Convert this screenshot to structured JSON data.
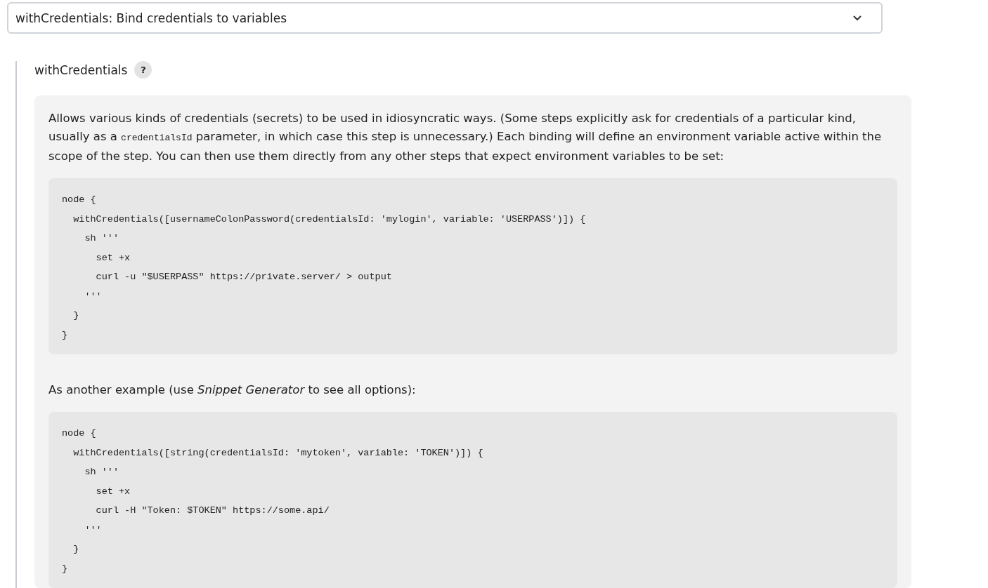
{
  "step_select": {
    "value": "withCredentials: Bind credentials to variables"
  },
  "step": {
    "label": "withCredentials",
    "help_icon": "?"
  },
  "help": {
    "intro": [
      {
        "kind": "text",
        "text": "Allows various kinds of credentials (secrets) to be used in idiosyncratic ways. (Some steps explicitly ask for credentials of a particular kind, usually as a "
      },
      {
        "kind": "code",
        "text": "credentialsId"
      },
      {
        "kind": "text",
        "text": " parameter, in which case this step is unnecessary.) Each binding will define an environment variable active within the scope of the step. You can then use them directly from any other steps that expect environment variables to be set:"
      }
    ],
    "example_1": [
      "node {",
      "  withCredentials([usernameColonPassword(credentialsId: 'mylogin', variable: 'USERPASS')]) {",
      "    sh '''",
      "      set +x",
      "      curl -u \"$USERPASS\" https://private.server/ > output",
      "    '''",
      "  }",
      "}"
    ],
    "between": "As another example (use *Snippet Generator* to see all options):",
    "example_2": [
      "node {",
      "  withCredentials([string(credentialsId: 'mytoken', variable: 'TOKEN')]) {",
      "    sh '''",
      "      set +x",
      "      curl -H \"Token: $TOKEN\" https://some.api/",
      "    '''",
      "  }",
      "}"
    ]
  }
}
